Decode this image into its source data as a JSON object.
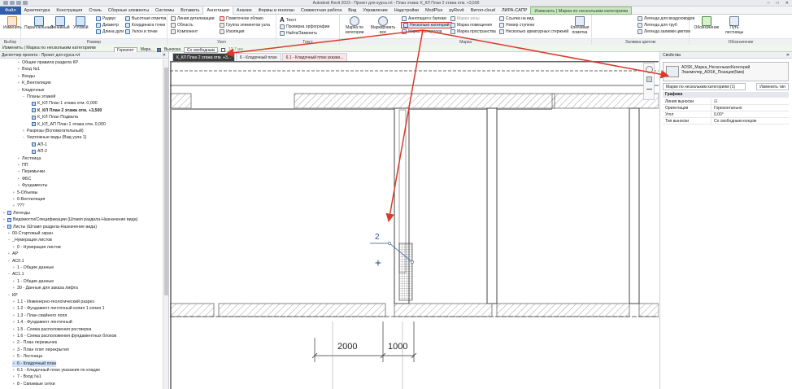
{
  "title_bar": {
    "title": "Autodesk Revit 2023 - Проект для курса.rvt - План этажа: К_КЛ План 2 этажа отм. +3,500"
  },
  "tabs": [
    "Файл",
    "Архитектура",
    "Конструкция",
    "Сталь",
    "Сборные элементы",
    "Системы",
    "Вставить",
    "Аннотации",
    "Анализ",
    "Формы и генплан",
    "Совместная работа",
    "Вид",
    "Управление",
    "Надстройки",
    "ModPlus",
    "pyRevit",
    "Витоп-cloud",
    "ЛИРА-САПР",
    "Изменить | Марка по нескольким категориям"
  ],
  "ribbon": {
    "panels": {
      "select": "Выбор",
      "dimension": "Размер",
      "detail": "Узел",
      "text": "Текст",
      "tag": "Марка",
      "color_fill": "Заливка цветом",
      "symbol": "Обозначение"
    },
    "buttons": {
      "modify": "Изменить",
      "aligned": "Параллельный",
      "linear": "Линейный",
      "angular": "Угловой",
      "radial": "Радиус",
      "diameter": "Диаметр",
      "arc_length": "Длина дуги",
      "spot_elevation": "Высотная отметка",
      "spot_coordinate": "Координата точки",
      "spot_slope": "Уклон в точке",
      "detail_line": "Линия детализации",
      "region": "Область",
      "component": "Компонент",
      "revision_cloud": "Пометочное облако",
      "detail_group": "Группа элементов узла",
      "insulation": "Изоляция",
      "text": "Текст",
      "check_spelling": "Проверка орфографии",
      "find_replace": "Найти/Заменить",
      "tag_by_category": "Марка по категории",
      "tag_all": "Маркировать все",
      "multi_category": "Несколько категорий",
      "material_tag": "Марка материала",
      "area_tag": "Марка зоны",
      "room_tag": "Марка помещения",
      "space_tag": "Марка пространства",
      "view_reference": "Ссылка на вид",
      "tread_number": "Номер ступени",
      "multi_rebar": "Несколько арматурных стержней",
      "beam_annotation": "Аннотация к балкам",
      "keynote": "Ключевая пометка",
      "duct_legend": "Легенда для воздуховодов",
      "pipe_legend": "Легенда для труб",
      "color_fill_legend": "Легенда заливки цветом",
      "symbol": "Обозначение",
      "stair_path": "Путь лестницы"
    }
  },
  "options_bar": {
    "text": "Изменить | Марка по нескольким категориям"
  },
  "view_controls": {
    "horizontal": "Горизонт",
    "tag_label": "Марк...",
    "leader_label": "Выноска",
    "leader_type": "Со свободным",
    "length": "12,7 мм"
  },
  "view_tabs": [
    {
      "label": "К_КЛ План 2 этажа отм. +3...",
      "active": true
    },
    {
      "label": "6 - Кладочный план",
      "active": false
    },
    {
      "label": "6.1 - Кладочный план указан...",
      "active": false
    }
  ],
  "project_browser": {
    "title": "Диспетчер проекта - Проект для курса.rvt",
    "nodes": [
      {
        "label": "Общие правила раздела КР",
        "indent": 3,
        "exp": "+"
      },
      {
        "label": "Вход №1",
        "indent": 3,
        "exp": "+"
      },
      {
        "label": "Входы",
        "indent": 3,
        "exp": "+"
      },
      {
        "label": "К_Вентиляция",
        "indent": 3,
        "exp": "+"
      },
      {
        "label": "Кладочные",
        "indent": 3,
        "exp": "−"
      },
      {
        "label": "Планы этажей",
        "indent": 4,
        "exp": "−"
      },
      {
        "label": "К_КЛ План 1 этажа отм. 0,000",
        "indent": 5,
        "exp": "",
        "icon": true
      },
      {
        "label": "К_КЛ План 2 этажа отм. +3,500",
        "indent": 5,
        "exp": "",
        "icon": true,
        "bold": true
      },
      {
        "label": "К_КЛ План Подвала",
        "indent": 5,
        "exp": "",
        "icon": true
      },
      {
        "label": "К_КЛ_АП План 1 этажа отм. 0,000",
        "indent": 5,
        "exp": "",
        "icon": true
      },
      {
        "label": "Разрезы (Вспомогательный)",
        "indent": 4,
        "exp": "+"
      },
      {
        "label": "Чертежные виды (Вид узла 1)",
        "indent": 4,
        "exp": "−"
      },
      {
        "label": "АП-1",
        "indent": 5,
        "exp": "",
        "icon": true
      },
      {
        "label": "АП-2",
        "indent": 5,
        "exp": "",
        "icon": true
      },
      {
        "label": "Лестница",
        "indent": 3,
        "exp": "+"
      },
      {
        "label": "ПП",
        "indent": 3,
        "exp": "+"
      },
      {
        "label": "Перемычки",
        "indent": 3,
        "exp": "+"
      },
      {
        "label": "ФБС",
        "indent": 3,
        "exp": "+"
      },
      {
        "label": "Фундаменты",
        "indent": 3,
        "exp": "+"
      },
      {
        "label": "5-Объемы",
        "indent": 2,
        "exp": "+"
      },
      {
        "label": "6-Вентиляция",
        "indent": 2,
        "exp": "+"
      },
      {
        "label": "???",
        "indent": 2,
        "exp": "+"
      },
      {
        "label": "Легенды",
        "indent": 0,
        "exp": "+",
        "icon": true
      },
      {
        "label": "Ведомости/Спецификации (Штамп раздела-Назначение вида)",
        "indent": 0,
        "exp": "+",
        "icon": true
      },
      {
        "label": "Листы (Штамп раздела-Назначение вида)",
        "indent": 0,
        "exp": "−",
        "icon": true
      },
      {
        "label": "00-Стартовый экран",
        "indent": 1,
        "exp": "+"
      },
      {
        "label": "_Нумерация листов",
        "indent": 1,
        "exp": "−"
      },
      {
        "label": "0 - Нумерация листов",
        "indent": 2,
        "exp": "+"
      },
      {
        "label": "АР",
        "indent": 1,
        "exp": "+"
      },
      {
        "label": "АС0.1",
        "indent": 1,
        "exp": "−"
      },
      {
        "label": "1 - Общие данные",
        "indent": 2,
        "exp": "+"
      },
      {
        "label": "АС1.1",
        "indent": 1,
        "exp": "−"
      },
      {
        "label": "1 - Общие данные",
        "indent": 2,
        "exp": "+"
      },
      {
        "label": "30 - Данные для заказа лифта",
        "indent": 2,
        "exp": "+"
      },
      {
        "label": "КР",
        "indent": 1,
        "exp": "−"
      },
      {
        "label": "1.1 - Инженерно-геологический разрез",
        "indent": 2,
        "exp": "+"
      },
      {
        "label": "1.2 - Фундамент ленточный копия 1 копия 1",
        "indent": 2,
        "exp": "+"
      },
      {
        "label": "1.3 - План свайного поля",
        "indent": 2,
        "exp": "+"
      },
      {
        "label": "1.4 - Фундамент ленточный",
        "indent": 2,
        "exp": "+"
      },
      {
        "label": "1.5 - Схема расположения ростверка",
        "indent": 2,
        "exp": "+"
      },
      {
        "label": "1.6 - Схема расположения фундаментных блоков",
        "indent": 2,
        "exp": "+"
      },
      {
        "label": "2 - План перемычек",
        "indent": 2,
        "exp": "+"
      },
      {
        "label": "3 - План плит перекрытия",
        "indent": 2,
        "exp": "+"
      },
      {
        "label": "5 - Лестница",
        "indent": 2,
        "exp": "+"
      },
      {
        "label": "6 - Кладочный план",
        "indent": 2,
        "exp": "+",
        "selected": true
      },
      {
        "label": "6.1 - Кладочный план указания по кладке",
        "indent": 2,
        "exp": "+"
      },
      {
        "label": "7 - Вход №1",
        "indent": 2,
        "exp": "+"
      },
      {
        "label": "8 - Связевые сетки",
        "indent": 2,
        "exp": "+"
      }
    ]
  },
  "properties": {
    "title": "Свойства",
    "type_name_1": "ADSK_Марка_НесколькихКатегорий",
    "type_name_2": "Экземпляр_ADSK_Позиция(5мм)",
    "selector": "Марки по нескольким категориям (1)",
    "edit_type": "Изменить тип",
    "group": "Графика",
    "rows": [
      {
        "key": "Линия выноски",
        "value": "☑"
      },
      {
        "key": "Ориентация",
        "value": "Горизонтально"
      },
      {
        "key": "Угол",
        "value": "0,00°"
      },
      {
        "key": "Тип выноски",
        "value": "Со свободным концом"
      }
    ]
  },
  "drawing": {
    "tag_number": "2",
    "dim_left": "2000",
    "dim_right": "1000"
  },
  "colors": {
    "accent": "#2f5fa8",
    "annotation_red": "#d93a2b",
    "context_tab": "#cde5c4"
  }
}
